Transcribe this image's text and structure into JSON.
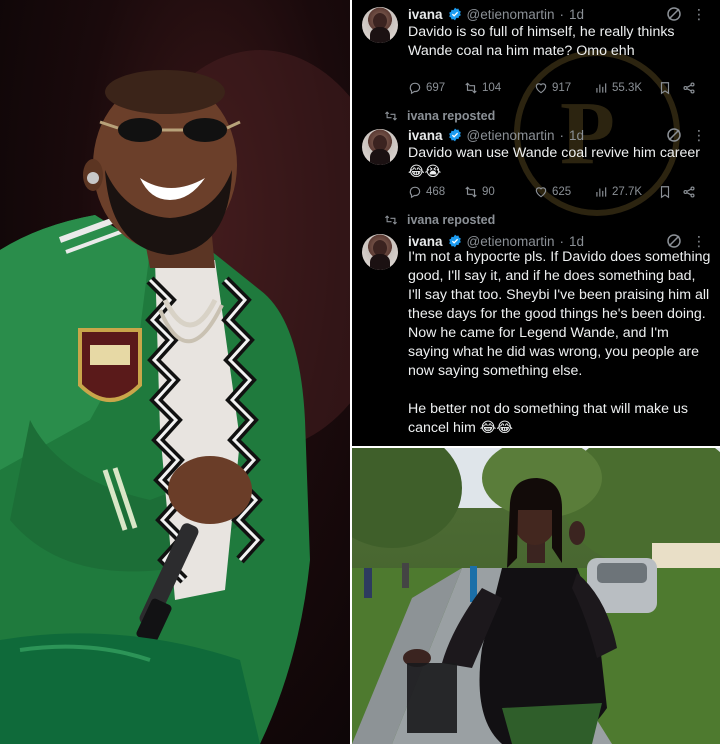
{
  "tweets": [
    {
      "repost_label": "",
      "name": "ivana",
      "handle": "@etienomartin",
      "time": "1d",
      "text": "Davido is so full of himself, he really thinks Wande coal na him mate? Omo ehh",
      "stats": {
        "replies": "697",
        "reposts": "104",
        "likes": "917",
        "views": "55.3K"
      }
    },
    {
      "repost_label": "ivana reposted",
      "name": "ivana",
      "handle": "@etienomartin",
      "time": "1d",
      "text": "Davido wan use Wande coal revive him career 😂😭",
      "stats": {
        "replies": "468",
        "reposts": "90",
        "likes": "625",
        "views": "27.7K"
      }
    },
    {
      "repost_label": "ivana reposted",
      "name": "ivana",
      "handle": "@etienomartin",
      "time": "1d",
      "text": "I'm not a hypocrte pls. If Davido does something good, I'll say it, and if he does something bad, I'll say that too. Sheybi I've been praising him all these days for the good things he's been doing. Now he came for Legend Wande, and I'm saying what he did was wrong, you people are now saying something else.\n\nHe better not do something that will make us cancel him 😂😂",
      "stats": {}
    }
  ],
  "colors": {
    "background": "#000000",
    "text": "#e7e9ea",
    "muted": "#8b9096",
    "verified": "#1d9bf0"
  },
  "icons": [
    "verified-badge-icon",
    "grok-icon",
    "more-icon",
    "reply-icon",
    "retweet-icon",
    "like-icon",
    "views-icon",
    "bookmark-icon",
    "share-icon"
  ]
}
